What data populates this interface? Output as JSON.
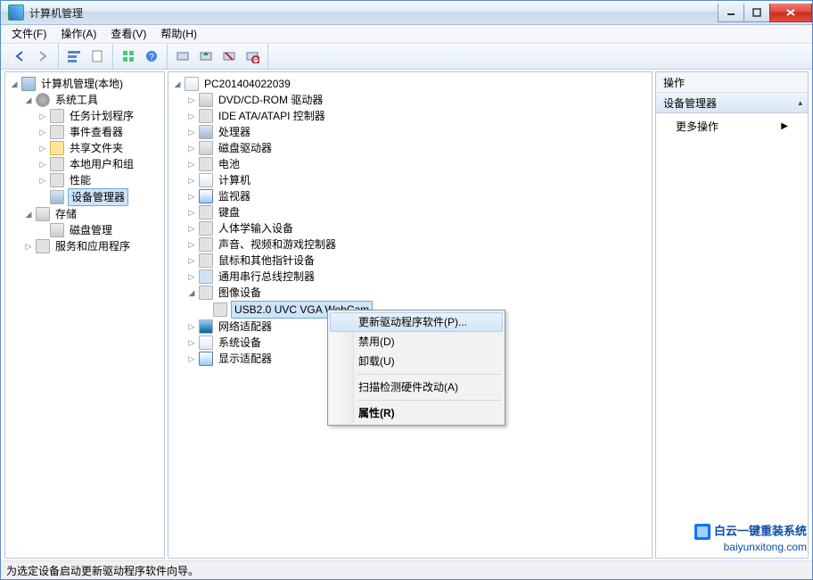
{
  "title": "计算机管理",
  "menu": {
    "file": "文件(F)",
    "action": "操作(A)",
    "view": "查看(V)",
    "help": "帮助(H)"
  },
  "status": "为选定设备启动更新驱动程序软件向导。",
  "left_tree": {
    "root": "计算机管理(本地)",
    "system_tools": "系统工具",
    "task_scheduler": "任务计划程序",
    "event_viewer": "事件查看器",
    "shared_folders": "共享文件夹",
    "local_users": "本地用户和组",
    "performance": "性能",
    "device_manager": "设备管理器",
    "storage": "存储",
    "disk_management": "磁盘管理",
    "services_apps": "服务和应用程序"
  },
  "center_root": "PC201404022039",
  "devices": {
    "dvd": "DVD/CD-ROM 驱动器",
    "ide": "IDE ATA/ATAPI 控制器",
    "cpu": "处理器",
    "disk": "磁盘驱动器",
    "battery": "电池",
    "computer": "计算机",
    "monitor": "监视器",
    "keyboard": "键盘",
    "hid": "人体学输入设备",
    "sound": "声音、视频和游戏控制器",
    "mouse": "鼠标和其他指针设备",
    "usb": "通用串行总线控制器",
    "imaging": "图像设备",
    "imaging_child": "USB2.0 UVC VGA WebCam",
    "network": "网络适配器",
    "system": "系统设备",
    "display": "显示适配器"
  },
  "context_menu": {
    "update": "更新驱动程序软件(P)...",
    "disable": "禁用(D)",
    "uninstall": "卸载(U)",
    "scan": "扫描检测硬件改动(A)",
    "properties": "属性(R)"
  },
  "right": {
    "header": "操作",
    "section": "设备管理器",
    "more": "更多操作"
  },
  "watermark": {
    "line1": "白云一键重装系统",
    "line2": "baiyunxitong.com"
  }
}
